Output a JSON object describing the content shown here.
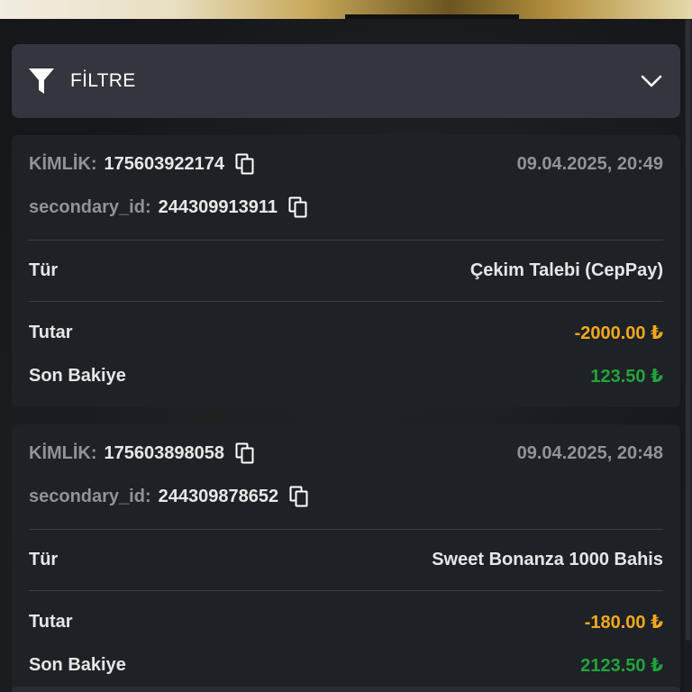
{
  "filter": {
    "label": "FİLTRE"
  },
  "colors": {
    "negative": "#f2a81d",
    "positive": "#22a33c",
    "muted": "#8f939a"
  },
  "transactions": [
    {
      "id_label": "KİMLİK:",
      "id_value": "175603922174",
      "secondary_label": "secondary_id:",
      "secondary_value": "244309913911",
      "datetime": "09.04.2025, 20:49",
      "type_label": "Tür",
      "type_value": "Çekim Talebi (CepPay)",
      "amount_label": "Tutar",
      "amount_value": "-2000.00 ₺",
      "balance_label": "Son Bakiye",
      "balance_value": "123.50 ₺"
    },
    {
      "id_label": "KİMLİK:",
      "id_value": "175603898058",
      "secondary_label": "secondary_id:",
      "secondary_value": "244309878652",
      "datetime": "09.04.2025, 20:48",
      "type_label": "Tür",
      "type_value": "Sweet Bonanza 1000 Bahis",
      "amount_label": "Tutar",
      "amount_value": "-180.00 ₺",
      "balance_label": "Son Bakiye",
      "balance_value": "2123.50 ₺"
    }
  ]
}
